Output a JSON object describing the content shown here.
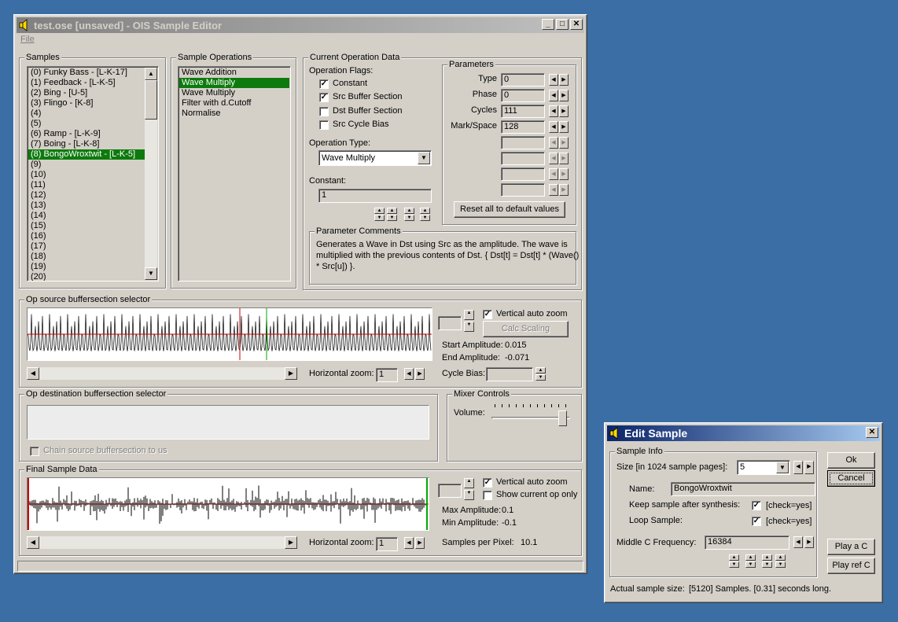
{
  "main": {
    "title": "test.ose [unsaved] - OIS Sample Editor",
    "menu_file": "File",
    "samples": {
      "label": "Samples",
      "items": [
        "(0) Funky Bass - [L-K-17]",
        "(1) Feedback - [L-K-5]",
        "(2) Bing - [U-5]",
        "(3) Flingo - [K-8]",
        "(4)",
        "(5)",
        "(6) Ramp - [L-K-9]",
        "(7) Boing - [L-K-8]",
        "(8) BongoWroxtwit - [L-K-5]",
        "(9)",
        "(10)",
        "(11)",
        "(12)",
        "(13)",
        "(14)",
        "(15)",
        "(16)",
        "(17)",
        "(18)",
        "(19)",
        "(20)"
      ],
      "selected_index": 8
    },
    "operations": {
      "label": "Sample Operations",
      "items": [
        "Wave Addition",
        "Wave Multiply",
        "Wave Multiply",
        "Filter with d.Cutoff",
        "Normalise"
      ],
      "selected_index": 1
    },
    "current_op": {
      "label": "Current Operation Data",
      "flags_label": "Operation Flags:",
      "flag_constant": "Constant",
      "flag_src": "Src Buffer Section",
      "flag_dst": "Dst Buffer Section",
      "flag_srccycle": "Src Cycle Bias",
      "optype_label": "Operation Type:",
      "optype_value": "Wave Multiply",
      "constant_label": "Constant:",
      "constant_value": "1",
      "params_label": "Parameters",
      "param_names": [
        "Type",
        "Phase",
        "Cycles",
        "Mark/Space"
      ],
      "param_values": [
        "0",
        "0",
        "111",
        "128"
      ],
      "reset_button": "Reset all to default values",
      "comments_label": "Parameter Comments",
      "comments_line1": "Generates a Wave in Dst using Src as the amplitude. The wave is",
      "comments_line2": "multiplied with the previous contents of Dst. { Dst[t] = Dst[t] * (Wave()",
      "comments_line3": "* Src[u]) }."
    },
    "src_selector": {
      "label": "Op source buffersection selector",
      "vzoom": "Vertical auto zoom",
      "calc_scaling": "Calc Scaling",
      "start_amp_label": "Start Amplitude:",
      "start_amp": "0.015",
      "end_amp_label": "End Amplitude:",
      "end_amp": "-0.071",
      "hzoom_label": "Horizontal zoom:",
      "hzoom": "1",
      "cycle_bias_label": "Cycle Bias:"
    },
    "dst_selector": {
      "label": "Op destination buffersection selector",
      "chain": "Chain source buffersection to us"
    },
    "mixer": {
      "label": "Mixer Controls",
      "volume_label": "Volume:",
      "volume_level": 0.95
    },
    "final": {
      "label": "Final Sample Data",
      "vzoom": "Vertical auto zoom",
      "show_current": "Show current op only",
      "max_amp_label": "Max Amplitude:",
      "max_amp": "0.1",
      "min_amp_label": "Min Amplitude:",
      "min_amp": "-0.1",
      "hzoom_label": "Horizontal zoom:",
      "hzoom": "1",
      "spp_label": "Samples per Pixel:",
      "spp": "10.1"
    }
  },
  "dialog": {
    "title": "Edit Sample",
    "info_label": "Sample Info",
    "size_label": "Size [in 1024 sample pages]:",
    "size_value": "5",
    "name_label": "Name:",
    "name_value": "BongoWroxtwit",
    "keep_label": "Keep sample after synthesis:",
    "keep_hint": "[check=yes]",
    "loop_label": "Loop Sample:",
    "loop_hint": "[check=yes]",
    "midc_label": "Middle C Frequency:",
    "midc_value": "16384",
    "ok": "Ok",
    "cancel": "Cancel",
    "play_c": "Play a C",
    "play_ref": "Play ref C",
    "actual_label": "Actual sample size:",
    "actual_value": "[5120] Samples. [0.31] seconds long."
  },
  "colors": {
    "desktop": "#3a6ea5",
    "selection": "#0d7a0d",
    "wave_center": "#cc0000",
    "marker_green": "#00aa00"
  }
}
